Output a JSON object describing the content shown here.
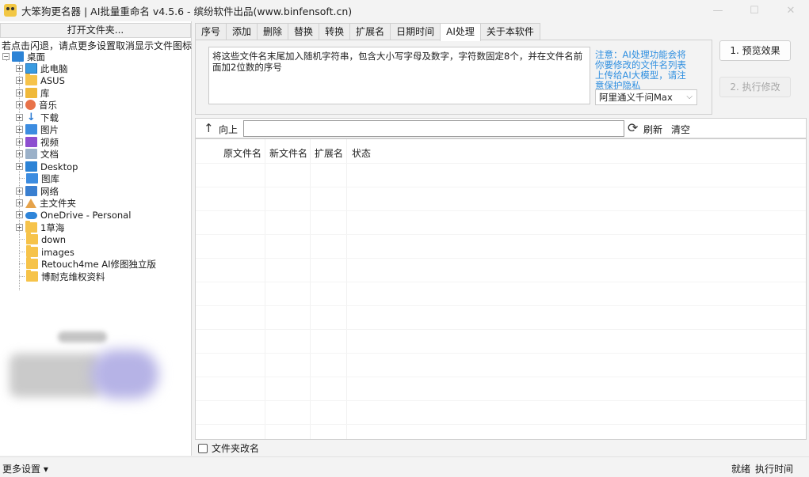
{
  "window": {
    "title": "大笨狗更名器 | AI批量重命名 v4.5.6 - 缤纷软件出品(www.binfensoft.cn)",
    "minimize": "—",
    "maximize": "☐",
    "close": "✕"
  },
  "left": {
    "open_folder": "打开文件夹...",
    "hint": "若点击闪退，请点更多设置取消显示文件图标",
    "tree": [
      {
        "label": "桌面",
        "icon": "desktop-icon",
        "expander": "−"
      },
      {
        "label": "此电脑",
        "icon": "computer-icon",
        "expander": "+"
      },
      {
        "label": "ASUS",
        "icon": "user-folder-icon",
        "expander": "+"
      },
      {
        "label": "库",
        "icon": "library-icon",
        "expander": "+"
      },
      {
        "label": "音乐",
        "icon": "music-icon",
        "expander": "+"
      },
      {
        "label": "下载",
        "icon": "download-icon",
        "expander": "+"
      },
      {
        "label": "图片",
        "icon": "pictures-icon",
        "expander": "+"
      },
      {
        "label": "视频",
        "icon": "videos-icon",
        "expander": "+"
      },
      {
        "label": "文档",
        "icon": "documents-icon",
        "expander": "+"
      },
      {
        "label": "Desktop",
        "icon": "desktop-folder-icon",
        "expander": "+"
      },
      {
        "label": "图库",
        "icon": "gallery-icon",
        "expander": ""
      },
      {
        "label": "网络",
        "icon": "network-icon",
        "expander": "+"
      },
      {
        "label": "主文件夹",
        "icon": "home-icon",
        "expander": "+"
      },
      {
        "label": "OneDrive - Personal",
        "icon": "onedrive-icon",
        "expander": "+"
      },
      {
        "label": "1草海",
        "icon": "folder-icon",
        "expander": "+"
      },
      {
        "label": "down",
        "icon": "folder-icon",
        "expander": ""
      },
      {
        "label": "images",
        "icon": "folder-icon",
        "expander": ""
      },
      {
        "label": "Retouch4me AI修图独立版",
        "icon": "folder-icon",
        "expander": ""
      },
      {
        "label": "博耐克维权资料",
        "icon": "folder-icon",
        "expander": ""
      }
    ]
  },
  "tabs": [
    "序号",
    "添加",
    "删除",
    "替换",
    "转换",
    "扩展名",
    "日期时间",
    "AI处理",
    "关于本软件"
  ],
  "active_tab": "AI处理",
  "ai": {
    "prompt": "将这些文件名末尾加入随机字符串，包含大小写字母及数字，字符数固定8个，并在文件名前面加2位数的序号",
    "notice": "注意：AI处理功能会将你要修改的文件名列表上传给AI大模型，请注意保护隐私",
    "model": "阿里通义千问Max"
  },
  "actions": {
    "preview": "1. 预览效果",
    "execute": "2. 执行修改"
  },
  "toolbar": {
    "up": "向上",
    "path": "",
    "refresh": "刷新",
    "clear": "清空"
  },
  "table": {
    "columns": [
      "原文件名",
      "新文件名",
      "扩展名",
      "状态"
    ]
  },
  "options": {
    "folder_rename": "文件夹改名"
  },
  "status": {
    "more_settings": "更多设置 ▾",
    "ready": "就绪",
    "exec_time": "执行时间"
  }
}
